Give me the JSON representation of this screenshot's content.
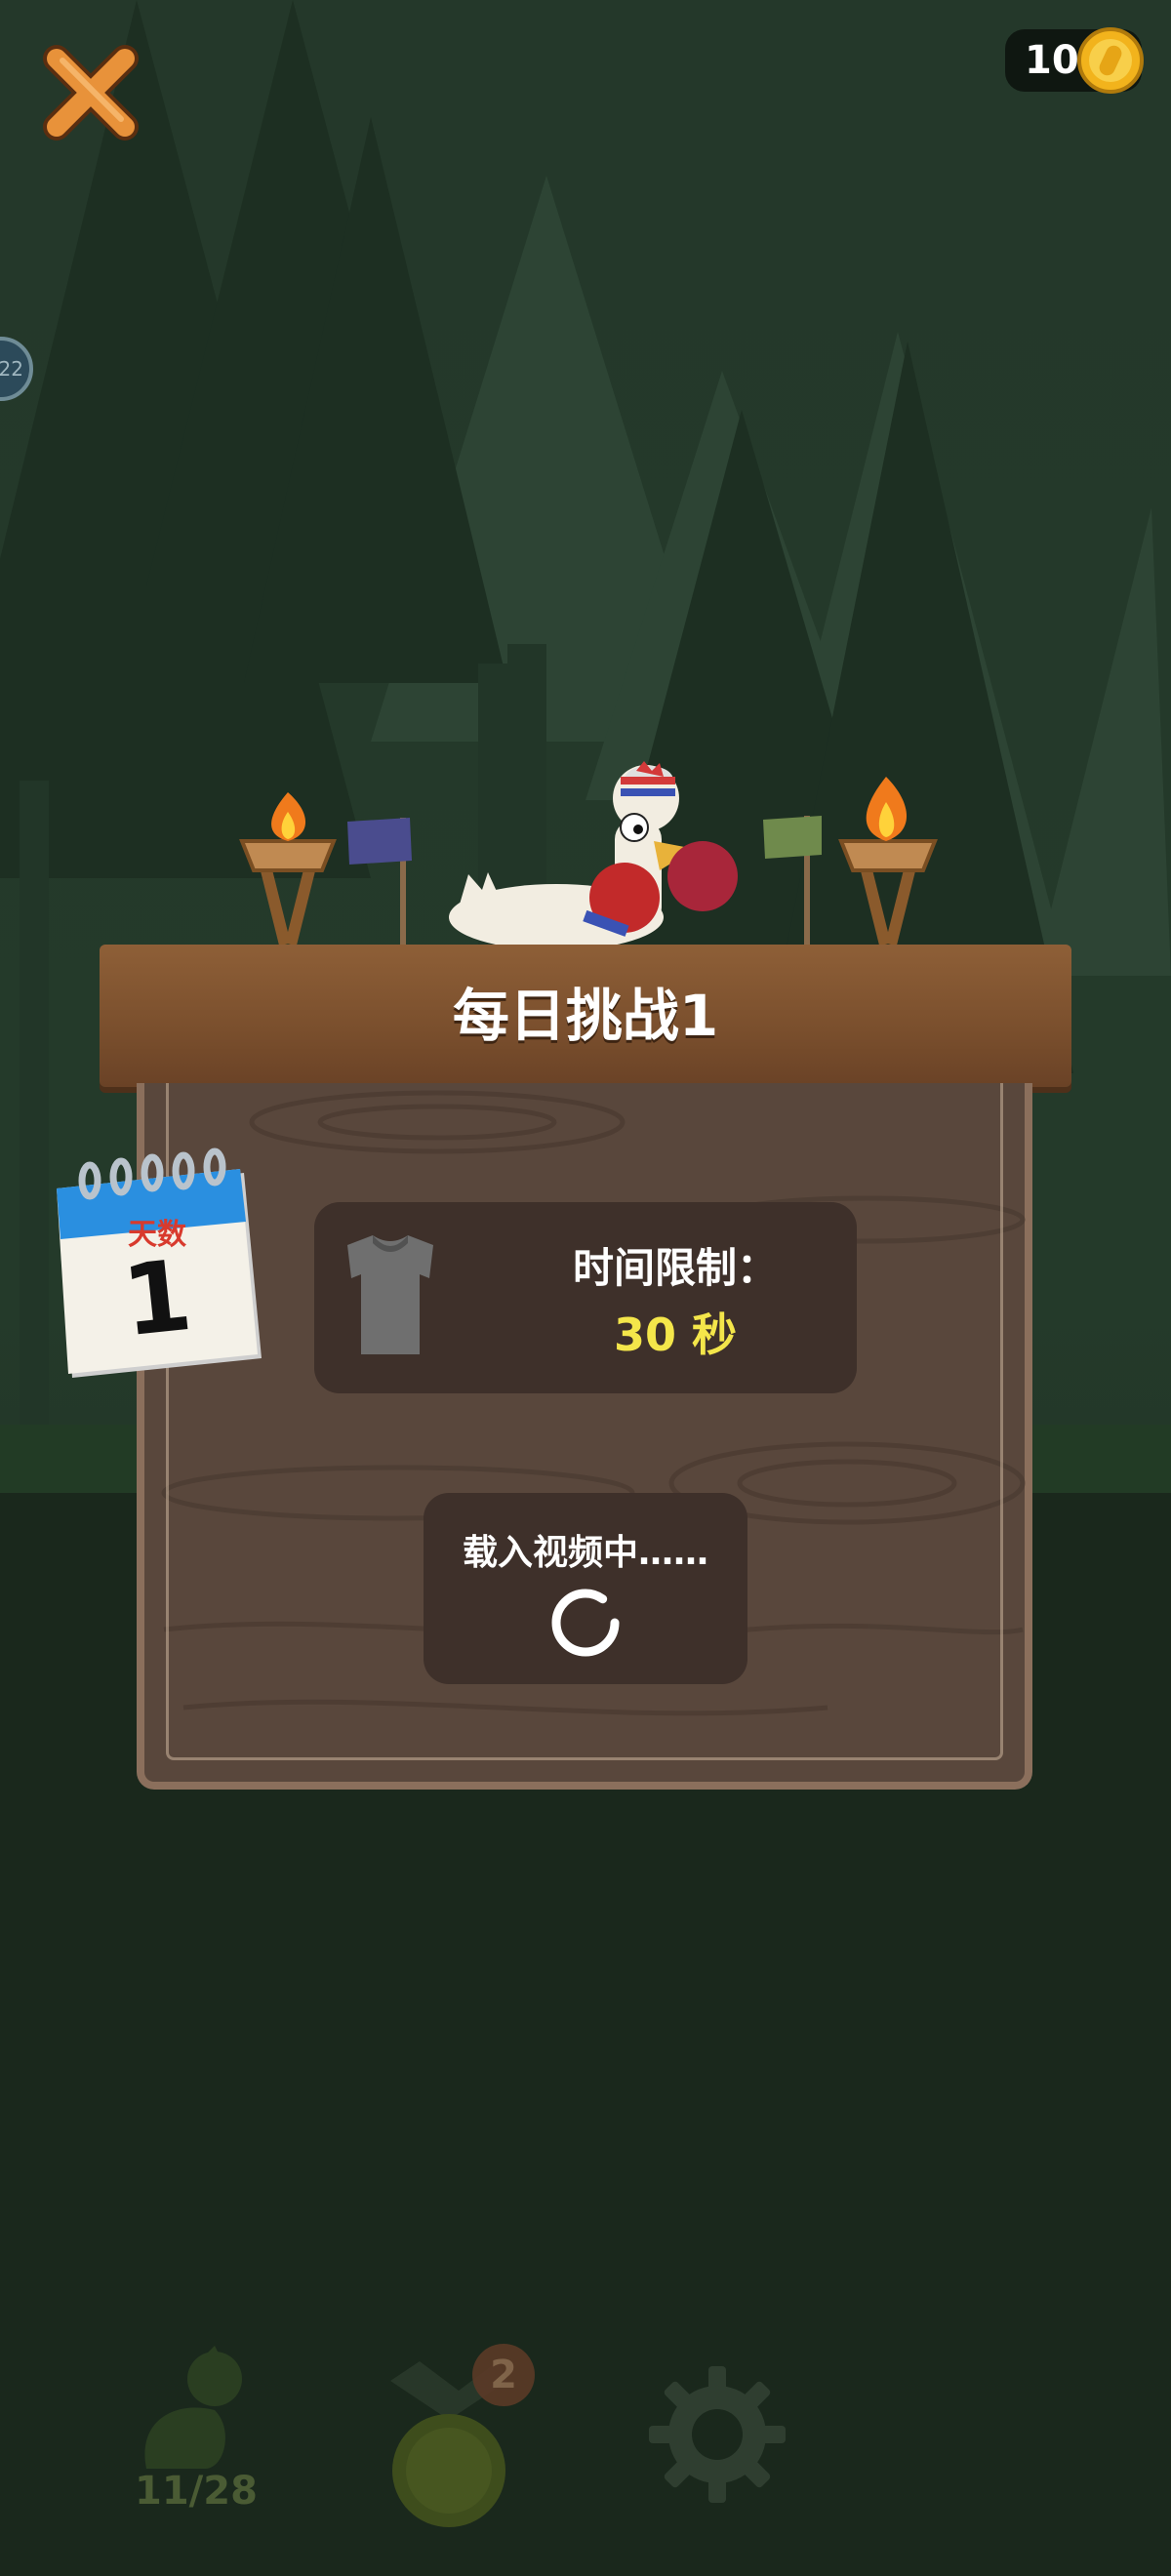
{
  "header": {
    "coins": "10"
  },
  "challenge": {
    "title": "每日挑战1",
    "calendar_label": "天数",
    "day_number": "1",
    "time_limit_label": "时间限制：",
    "time_limit_value": "30 秒",
    "loading_text": "载入视频中……"
  },
  "bottom_nav": {
    "characters_progress": "11/28",
    "rewards_badge": "2"
  },
  "colors": {
    "time_value": "#f4e64a",
    "calendar_label": "#d83a2d",
    "coin": "#f2b31c"
  }
}
